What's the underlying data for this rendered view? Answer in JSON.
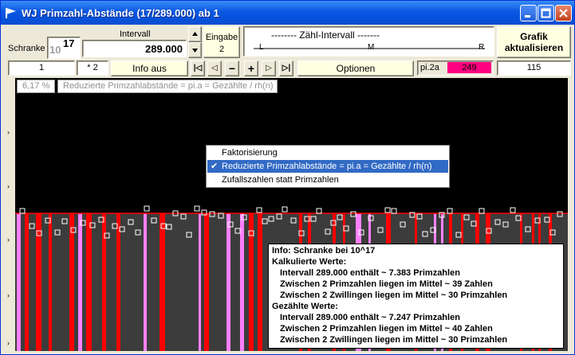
{
  "window": {
    "title": "WJ Primzahl-Abstände (17/289.000) ab 1"
  },
  "toolbar": {
    "schranke_label": "Schranke",
    "schranke_base": "10",
    "schranke_exp": "17",
    "intervall_label": "Intervall",
    "intervall_value": "289.000",
    "eingabe_label": "Eingabe",
    "eingabe_value": "2",
    "zaehl_title": "-------- Zähl-Intervall -------",
    "zaehl_l": "L",
    "zaehl_m": "M",
    "zaehl_r": "R",
    "grafik_line1": "Grafik",
    "grafik_line2": "aktualisieren",
    "field_one": "1",
    "field_mult": "* 2",
    "info_aus": "Info aus",
    "nav_first": "|◁",
    "nav_prev": "◁",
    "nav_minus": "−",
    "nav_plus": "+",
    "nav_next": "▷",
    "nav_last": "▷|",
    "optionen": "Optionen",
    "pi_label": "pi.2a",
    "pi_value": "249",
    "right_value": "115"
  },
  "plot": {
    "percent": "6,17 %",
    "caption": "Reduzierte Primzahlabstände = pi.a = Gezählte / rh(n)",
    "colors": {
      "bg": "#000000",
      "dark": "#3c3c3c",
      "red": "#ff0000",
      "pink": "#ff80ff",
      "marker": "#ffffff",
      "line": "#ff0000"
    }
  },
  "menu": {
    "items": [
      {
        "label": "Faktorisierung",
        "checked": false
      },
      {
        "label": "Reduzierte Primzahlabstände = pi.a = Gezählte / rh(n)",
        "checked": true
      },
      {
        "label": "Zufallszahlen statt Primzahlen",
        "checked": false
      }
    ]
  },
  "info": {
    "lines": [
      "Info:  Schranke bei 10^17",
      "Kalkulierte Werte:",
      "Intervall 289.000 enthält ~ 7.383 Primzahlen",
      "Zwischen 2 Primzahlen liegen im Mittel ~ 39 Zahlen",
      "Zwischen 2 Zwillingen liegen im Mittel ~ 30 Primzahlen",
      "Gezählte Werte:",
      "Intervall 289.000 enthält ~ 7.247 Primzahlen",
      "Zwischen 2 Primzahlen liegen im Mittel ~ 40 Zahlen",
      "Zwischen 2 Zwillingen liegen im Mittel ~ 30 Primzahlen"
    ]
  }
}
